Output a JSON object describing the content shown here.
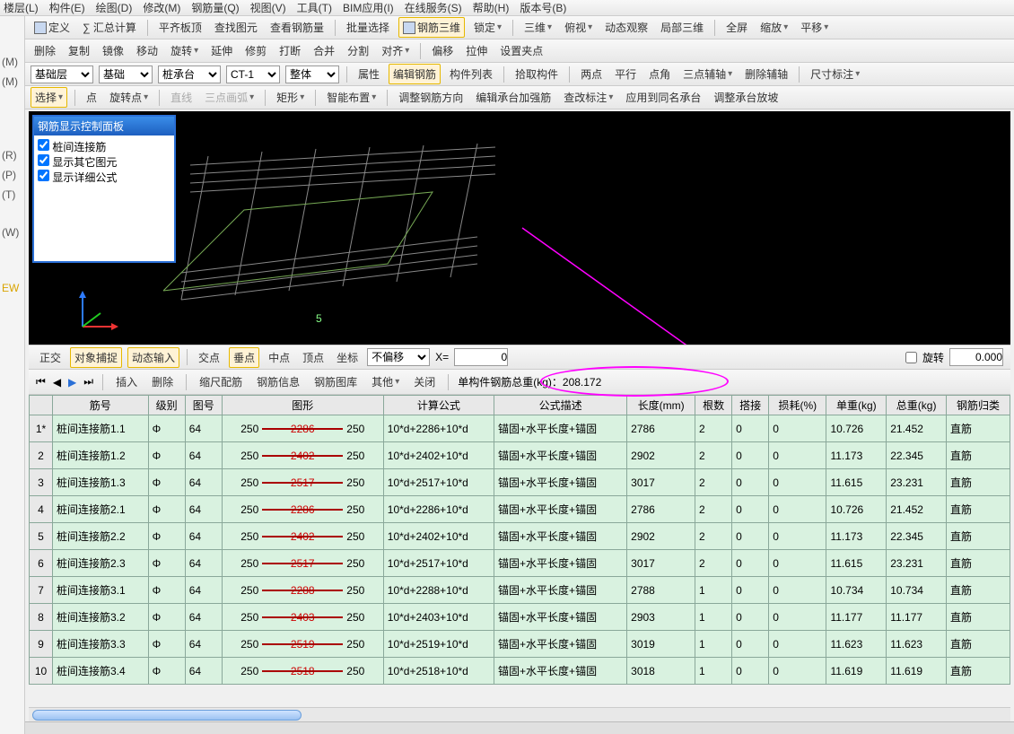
{
  "menu": {
    "items": [
      "楼层(L)",
      "构件(E)",
      "绘图(D)",
      "修改(M)",
      "钢筋量(Q)",
      "视图(V)",
      "工具(T)",
      "BIM应用(I)",
      "在线服务(S)",
      "帮助(H)",
      "版本号(B)"
    ]
  },
  "toolbar1": {
    "define": "定义",
    "sumcalc": "∑ 汇总计算",
    "flattop": "平齐板顶",
    "findpic": "查找图元",
    "viewrebar": "查看钢筋量",
    "batchsel": "批量选择",
    "rebar3d": "钢筋三维",
    "lock": "锁定",
    "three_d": "三维",
    "overlook": "俯视",
    "dynview": "动态观察",
    "local3d": "局部三维",
    "fullscreen": "全屏",
    "zoom": "缩放",
    "pan": "平移"
  },
  "toolbar2": {
    "delete": "删除",
    "copy": "复制",
    "mirror": "镜像",
    "move": "移动",
    "rotate": "旋转",
    "extend": "延伸",
    "trim": "修剪",
    "break": "打断",
    "merge": "合并",
    "split": "分割",
    "align": "对齐",
    "offset": "偏移",
    "stretch": "拉伸",
    "setpt": "设置夹点"
  },
  "toolbar3": {
    "layer": "基础层",
    "base": "基础",
    "pile": "桩承台",
    "ct": "CT-1",
    "whole": "整体",
    "attr": "属性",
    "editrebar": "编辑钢筋",
    "complist": "构件列表",
    "pickcomp": "拾取构件",
    "twopt": "两点",
    "parallel": "平行",
    "ptangle": "点角",
    "threept": "三点辅轴",
    "delaux": "删除辅轴",
    "dim": "尺寸标注"
  },
  "toolbar4": {
    "select": "选择",
    "point": "点",
    "rotpt": "旋转点",
    "line": "直线",
    "arc3pt": "三点画弧",
    "rect": "矩形",
    "autoarr": "智能布置",
    "adjdir": "调整钢筋方向",
    "editbear": "编辑承台加强筋",
    "editnote": "查改标注",
    "applysame": "应用到同名承台",
    "adjslope": "调整承台放坡"
  },
  "panel": {
    "title": "钢筋显示控制面板",
    "opt1": "桩间连接筋",
    "opt2": "显示其它图元",
    "opt3": "显示详细公式"
  },
  "statusbar": {
    "ortho": "正交",
    "snap": "对象捕捉",
    "dyninput": "动态输入",
    "intersect": "交点",
    "perp": "垂点",
    "mid": "中点",
    "vertex": "顶点",
    "coord": "坐标",
    "nooffset": "不偏移",
    "xlabel": "X=",
    "xval": "0",
    "rotlabel": "旋转",
    "rotval": "0.000"
  },
  "navbar": {
    "insert": "插入",
    "delete": "删除",
    "scale": "缩尺配筋",
    "rebarinfo": "钢筋信息",
    "rebarlib": "钢筋图库",
    "other": "其他",
    "close": "关闭",
    "total_label": "单构件钢筋总重(kg)：",
    "total_val": "208.172"
  },
  "columns": [
    "",
    "筋号",
    "级别",
    "图号",
    "图形",
    "计算公式",
    "公式描述",
    "长度(mm)",
    "根数",
    "搭接",
    "损耗(%)",
    "单重(kg)",
    "总重(kg)",
    "钢筋归类"
  ],
  "rows": [
    {
      "n": "1*",
      "name": "桩间连接筋1.1",
      "grade": "Φ",
      "fig": "64",
      "l": "250",
      "mid": "2286",
      "r": "250",
      "formula": "10*d+2286+10*d",
      "desc": "锚固+水平长度+锚固",
      "len": "2786",
      "cnt": "2",
      "lap": "0",
      "loss": "0",
      "uw": "10.726",
      "tw": "21.452",
      "cat": "直筋"
    },
    {
      "n": "2",
      "name": "桩间连接筋1.2",
      "grade": "Φ",
      "fig": "64",
      "l": "250",
      "mid": "2402",
      "r": "250",
      "formula": "10*d+2402+10*d",
      "desc": "锚固+水平长度+锚固",
      "len": "2902",
      "cnt": "2",
      "lap": "0",
      "loss": "0",
      "uw": "11.173",
      "tw": "22.345",
      "cat": "直筋"
    },
    {
      "n": "3",
      "name": "桩间连接筋1.3",
      "grade": "Φ",
      "fig": "64",
      "l": "250",
      "mid": "2517",
      "r": "250",
      "formula": "10*d+2517+10*d",
      "desc": "锚固+水平长度+锚固",
      "len": "3017",
      "cnt": "2",
      "lap": "0",
      "loss": "0",
      "uw": "11.615",
      "tw": "23.231",
      "cat": "直筋"
    },
    {
      "n": "4",
      "name": "桩间连接筋2.1",
      "grade": "Φ",
      "fig": "64",
      "l": "250",
      "mid": "2286",
      "r": "250",
      "formula": "10*d+2286+10*d",
      "desc": "锚固+水平长度+锚固",
      "len": "2786",
      "cnt": "2",
      "lap": "0",
      "loss": "0",
      "uw": "10.726",
      "tw": "21.452",
      "cat": "直筋"
    },
    {
      "n": "5",
      "name": "桩间连接筋2.2",
      "grade": "Φ",
      "fig": "64",
      "l": "250",
      "mid": "2402",
      "r": "250",
      "formula": "10*d+2402+10*d",
      "desc": "锚固+水平长度+锚固",
      "len": "2902",
      "cnt": "2",
      "lap": "0",
      "loss": "0",
      "uw": "11.173",
      "tw": "22.345",
      "cat": "直筋"
    },
    {
      "n": "6",
      "name": "桩间连接筋2.3",
      "grade": "Φ",
      "fig": "64",
      "l": "250",
      "mid": "2517",
      "r": "250",
      "formula": "10*d+2517+10*d",
      "desc": "锚固+水平长度+锚固",
      "len": "3017",
      "cnt": "2",
      "lap": "0",
      "loss": "0",
      "uw": "11.615",
      "tw": "23.231",
      "cat": "直筋"
    },
    {
      "n": "7",
      "name": "桩间连接筋3.1",
      "grade": "Φ",
      "fig": "64",
      "l": "250",
      "mid": "2288",
      "r": "250",
      "formula": "10*d+2288+10*d",
      "desc": "锚固+水平长度+锚固",
      "len": "2788",
      "cnt": "1",
      "lap": "0",
      "loss": "0",
      "uw": "10.734",
      "tw": "10.734",
      "cat": "直筋"
    },
    {
      "n": "8",
      "name": "桩间连接筋3.2",
      "grade": "Φ",
      "fig": "64",
      "l": "250",
      "mid": "2403",
      "r": "250",
      "formula": "10*d+2403+10*d",
      "desc": "锚固+水平长度+锚固",
      "len": "2903",
      "cnt": "1",
      "lap": "0",
      "loss": "0",
      "uw": "11.177",
      "tw": "11.177",
      "cat": "直筋"
    },
    {
      "n": "9",
      "name": "桩间连接筋3.3",
      "grade": "Φ",
      "fig": "64",
      "l": "250",
      "mid": "2519",
      "r": "250",
      "formula": "10*d+2519+10*d",
      "desc": "锚固+水平长度+锚固",
      "len": "3019",
      "cnt": "1",
      "lap": "0",
      "loss": "0",
      "uw": "11.623",
      "tw": "11.623",
      "cat": "直筋"
    },
    {
      "n": "10",
      "name": "桩间连接筋3.4",
      "grade": "Φ",
      "fig": "64",
      "l": "250",
      "mid": "2518",
      "r": "250",
      "formula": "10*d+2518+10*d",
      "desc": "锚固+水平长度+锚固",
      "len": "3018",
      "cnt": "1",
      "lap": "0",
      "loss": "0",
      "uw": "11.619",
      "tw": "11.619",
      "cat": "直筋"
    }
  ],
  "left_hints": [
    "(M)",
    "(M)",
    "(R)",
    "(P)",
    "(T)",
    "(W)",
    "EW"
  ]
}
